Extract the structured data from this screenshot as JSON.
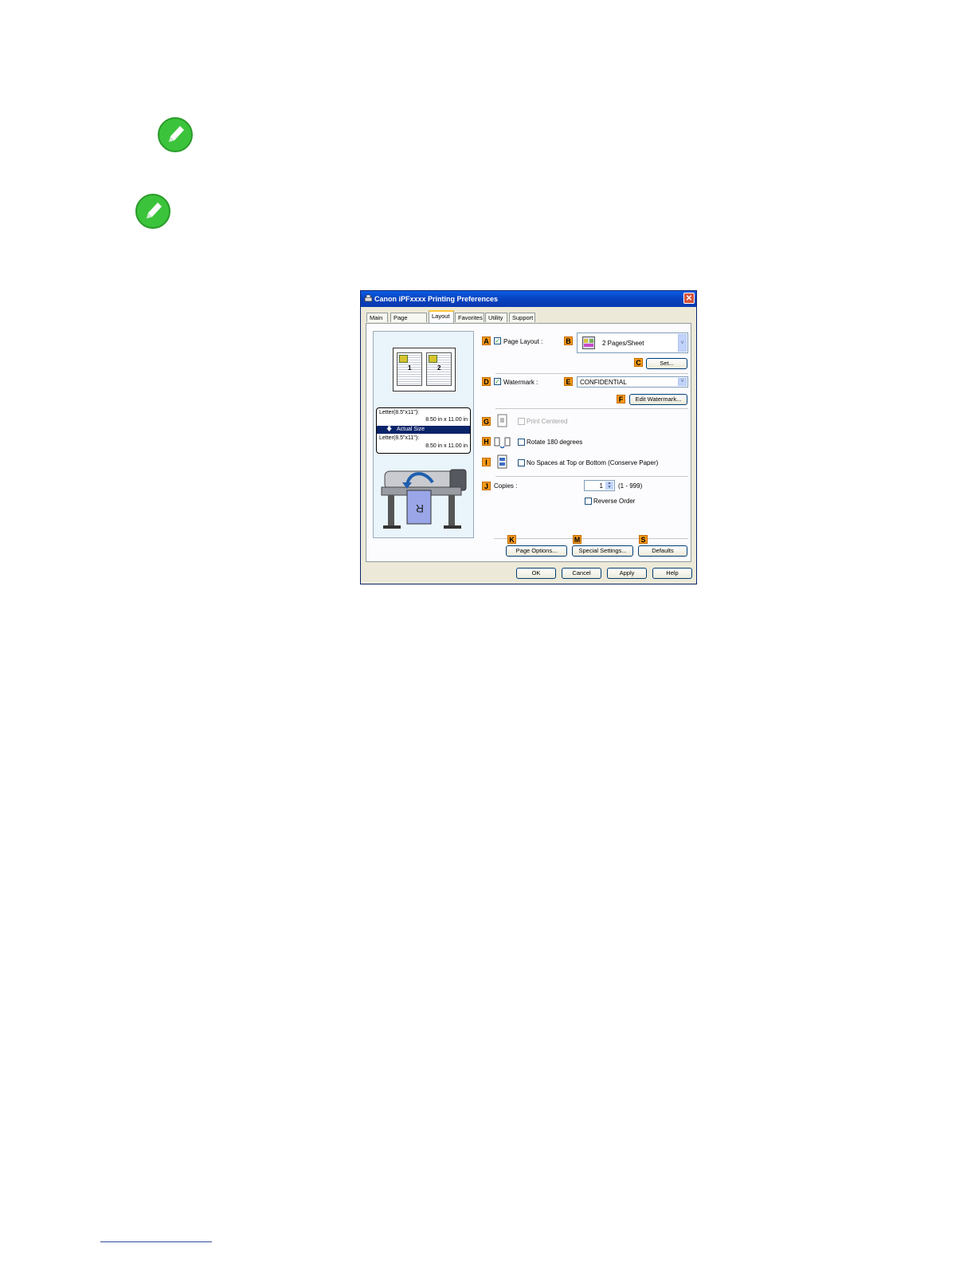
{
  "notes": [
    {
      "icon": "pencil-note-icon",
      "color": "#33c433"
    },
    {
      "icon": "pencil-note-icon",
      "color": "#33c433"
    }
  ],
  "dialog": {
    "title": "Canon iPFxxxx Printing Preferences",
    "close_label": "✕",
    "tabs": [
      {
        "label": "Main",
        "active": false
      },
      {
        "label": "Page Setup",
        "active": false
      },
      {
        "label": "Layout",
        "active": true
      },
      {
        "label": "Favorites",
        "active": false
      },
      {
        "label": "Utility",
        "active": false
      },
      {
        "label": "Support",
        "active": false
      }
    ],
    "preview": {
      "page_numbers": [
        "1",
        "2"
      ],
      "size_top_name": "Letter(8.5\"x11\"):",
      "size_top_dims": "8.50 in x 11.00 in",
      "actual_size": "Actual Size",
      "size_bottom_name": "Letter(8.5\"x11\"):",
      "size_bottom_dims": "8.50 in x 11.00 in",
      "paper_letter": "R"
    },
    "markers": {
      "A": "A",
      "B": "B",
      "C": "C",
      "D": "D",
      "E": "E",
      "F": "F",
      "G": "G",
      "H": "H",
      "I": "I",
      "J": "J",
      "K": "K",
      "M": "M",
      "S": "S"
    },
    "page_layout": {
      "label": "Page Layout :",
      "checked": true,
      "value": "2 Pages/Sheet",
      "set_button": "Set..."
    },
    "watermark": {
      "label": "Watermark :",
      "checked": true,
      "value": "CONFIDENTIAL",
      "edit_button": "Edit Watermark..."
    },
    "print_centered": {
      "label": "Print Centered",
      "checked": false,
      "disabled": true
    },
    "rotate": {
      "label": "Rotate 180 degrees",
      "checked": false
    },
    "no_spaces": {
      "label": "No Spaces at Top or Bottom (Conserve Paper)",
      "checked": false
    },
    "copies": {
      "label": "Copies :",
      "value": "1",
      "range": "(1 - 999)"
    },
    "reverse_order": {
      "label": "Reverse Order",
      "checked": false
    },
    "buttons": {
      "page_options": "Page Options...",
      "special_settings": "Special Settings...",
      "defaults": "Defaults",
      "ok": "OK",
      "cancel": "Cancel",
      "apply": "Apply",
      "help": "Help"
    },
    "accent_color": "#f59a1a",
    "title_bar_color": "#0843c0"
  }
}
